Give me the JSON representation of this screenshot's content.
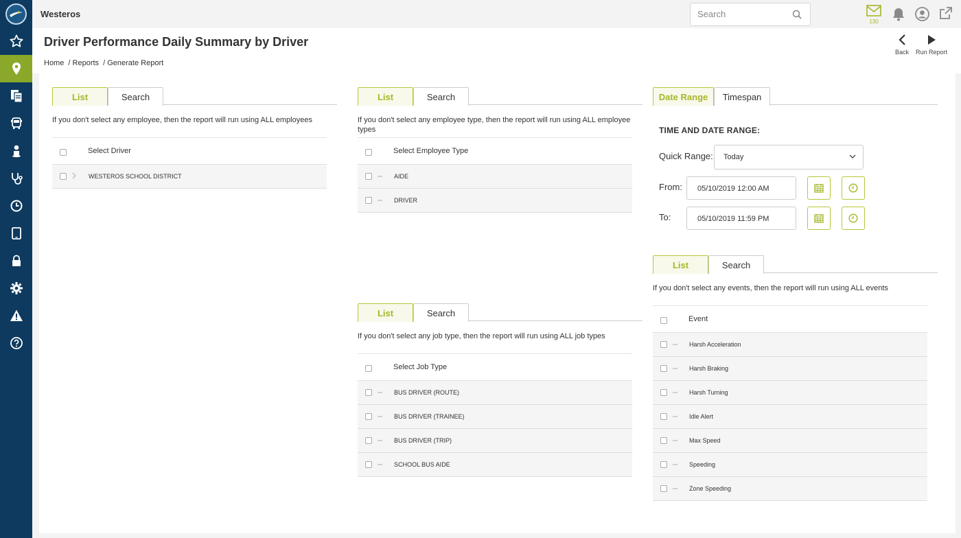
{
  "app": {
    "title": "Westeros"
  },
  "search": {
    "placeholder": "Search"
  },
  "notifications": {
    "mail_count": "130"
  },
  "page": {
    "title": "Driver Performance Daily Summary by Driver"
  },
  "breadcrumb": [
    "Home",
    "/ Reports",
    "/ Generate Report"
  ],
  "header_actions": {
    "back_label": "Back",
    "run_label": "Run Report"
  },
  "sidebar": {
    "items": [
      {
        "icon": "star-icon"
      },
      {
        "icon": "map-pin-icon",
        "active": true
      },
      {
        "icon": "documents-icon"
      },
      {
        "icon": "bus-icon"
      },
      {
        "icon": "driver-icon"
      },
      {
        "icon": "stethoscope-icon"
      },
      {
        "icon": "clock-icon"
      },
      {
        "icon": "tablet-icon"
      },
      {
        "icon": "lock-icon"
      },
      {
        "icon": "gear-icon"
      },
      {
        "icon": "warning-icon"
      },
      {
        "icon": "help-icon"
      }
    ]
  },
  "drivers": {
    "tabs": [
      "List",
      "Search"
    ],
    "hint": "If you don't select any employee, then the report will run using ALL employees",
    "header": "Select Driver",
    "rows": [
      "WESTEROS SCHOOL DISTRICT"
    ]
  },
  "employee_types": {
    "tabs": [
      "List",
      "Search"
    ],
    "hint": "If you don't select any employee type, then the report will run using ALL employee types",
    "header": "Select Employee Type",
    "rows": [
      "AIDE",
      "DRIVER"
    ]
  },
  "job_types": {
    "tabs": [
      "List",
      "Search"
    ],
    "hint": "If you don't select any job type, then the report will run using ALL job types",
    "header": "Select Job Type",
    "rows": [
      "BUS DRIVER (ROUTE)",
      "BUS DRIVER (TRAINEE)",
      "BUS DRIVER (TRIP)",
      "SCHOOL BUS AIDE"
    ]
  },
  "date_range": {
    "tabs": [
      "Date Range",
      "Timespan"
    ],
    "title": "TIME AND DATE RANGE:",
    "quick_range_label": "Quick Range:",
    "quick_range_value": "Today",
    "from_label": "From:",
    "from_value": "05/10/2019 12:00 AM",
    "to_label": "To:",
    "to_value": "05/10/2019 11:59 PM"
  },
  "events": {
    "tabs": [
      "List",
      "Search"
    ],
    "hint": "If you don't select any events, then the report will run using ALL events",
    "header": "Event",
    "rows": [
      "Harsh Acceleration",
      "Harsh Braking",
      "Harsh Turning",
      "Idle Alert",
      "Max Speed",
      "Speeding",
      "Zone Speeding"
    ]
  },
  "colors": {
    "accent": "#a7b628",
    "sidebar": "#0e3a5f",
    "sidebar_active": "#8aa82a"
  }
}
